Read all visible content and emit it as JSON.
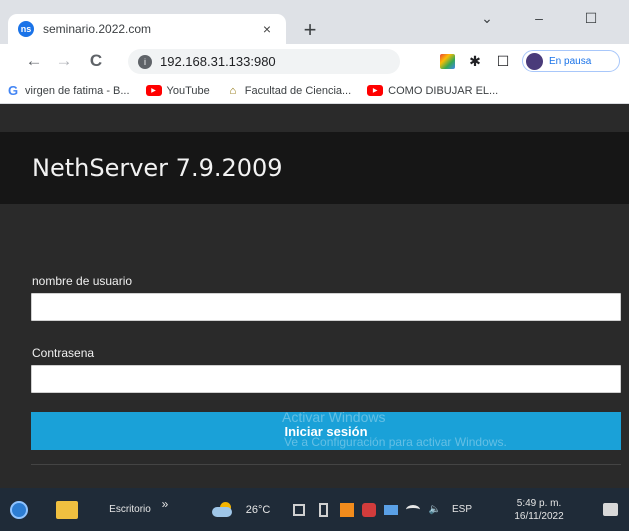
{
  "browser": {
    "tab": {
      "favicon_letter": "ns",
      "title": "seminario.2022.com",
      "close_glyph": "×"
    },
    "new_tab_glyph": "+",
    "window_controls": {
      "tab_search": "⌄",
      "minimize": "–",
      "maximize": "☐"
    },
    "nav": {
      "back": "←",
      "forward": "→",
      "reload": "C"
    },
    "address": {
      "info_glyph": "i",
      "url": "192.168.31.133:980"
    },
    "extensions": {
      "puzzle": "✱",
      "sidepanel": "☐"
    },
    "profile": {
      "label": "En pausa"
    },
    "bookmarks": [
      {
        "icon": "google-icon",
        "glyph": "G",
        "label": "virgen de fatima - B..."
      },
      {
        "icon": "youtube-icon",
        "glyph": "▶",
        "label": "YouTube"
      },
      {
        "icon": "university-icon",
        "glyph": "⌂",
        "label": "Facultad de Ciencia..."
      },
      {
        "icon": "youtube-icon",
        "glyph": "▶",
        "label": "COMO DIBUJAR EL..."
      }
    ]
  },
  "page": {
    "product_title": "NethServer 7.9.2009",
    "username": {
      "label": "nombre de usuario",
      "value": ""
    },
    "password": {
      "label": "Contrasena",
      "value": ""
    },
    "login_button": "Iniciar sesión",
    "watermark": {
      "line1": "Activar Windows",
      "line2": "Ve a Configuración para activar Windows."
    }
  },
  "taskbar": {
    "desktop_label": "Escritorio",
    "overflow_glyph": "»",
    "temperature": "26°C",
    "language": "ESP",
    "time": "5:49 p. m.",
    "date": "16/11/2022",
    "volume_glyph": "🔈"
  },
  "colors": {
    "login_button": "#1aa1d8",
    "page_bg": "#2a2a2a",
    "header_bg": "#161616",
    "taskbar_bg": "#1f2b38"
  }
}
